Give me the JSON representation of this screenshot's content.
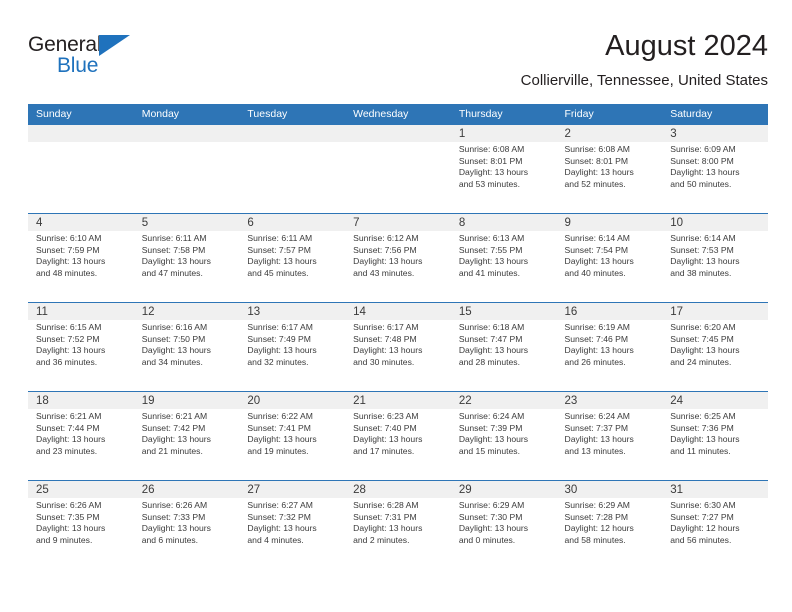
{
  "brand": {
    "name_part1": "General",
    "name_part2": "Blue",
    "accent_color": "#1f72bd"
  },
  "header": {
    "month_title": "August 2024",
    "location": "Collierville, Tennessee, United States"
  },
  "theme": {
    "header_blue": "#2e75b6",
    "day_band_gray": "#f0f0f0",
    "text_color": "#3b3b3b"
  },
  "calendar": {
    "weekday_headers": [
      "Sunday",
      "Monday",
      "Tuesday",
      "Wednesday",
      "Thursday",
      "Friday",
      "Saturday"
    ],
    "weeks": [
      [
        {
          "day": "",
          "sunrise": "",
          "sunset": "",
          "daylight_line1": "",
          "daylight_line2": ""
        },
        {
          "day": "",
          "sunrise": "",
          "sunset": "",
          "daylight_line1": "",
          "daylight_line2": ""
        },
        {
          "day": "",
          "sunrise": "",
          "sunset": "",
          "daylight_line1": "",
          "daylight_line2": ""
        },
        {
          "day": "",
          "sunrise": "",
          "sunset": "",
          "daylight_line1": "",
          "daylight_line2": ""
        },
        {
          "day": "1",
          "sunrise": "Sunrise: 6:08 AM",
          "sunset": "Sunset: 8:01 PM",
          "daylight_line1": "Daylight: 13 hours",
          "daylight_line2": "and 53 minutes."
        },
        {
          "day": "2",
          "sunrise": "Sunrise: 6:08 AM",
          "sunset": "Sunset: 8:01 PM",
          "daylight_line1": "Daylight: 13 hours",
          "daylight_line2": "and 52 minutes."
        },
        {
          "day": "3",
          "sunrise": "Sunrise: 6:09 AM",
          "sunset": "Sunset: 8:00 PM",
          "daylight_line1": "Daylight: 13 hours",
          "daylight_line2": "and 50 minutes."
        }
      ],
      [
        {
          "day": "4",
          "sunrise": "Sunrise: 6:10 AM",
          "sunset": "Sunset: 7:59 PM",
          "daylight_line1": "Daylight: 13 hours",
          "daylight_line2": "and 48 minutes."
        },
        {
          "day": "5",
          "sunrise": "Sunrise: 6:11 AM",
          "sunset": "Sunset: 7:58 PM",
          "daylight_line1": "Daylight: 13 hours",
          "daylight_line2": "and 47 minutes."
        },
        {
          "day": "6",
          "sunrise": "Sunrise: 6:11 AM",
          "sunset": "Sunset: 7:57 PM",
          "daylight_line1": "Daylight: 13 hours",
          "daylight_line2": "and 45 minutes."
        },
        {
          "day": "7",
          "sunrise": "Sunrise: 6:12 AM",
          "sunset": "Sunset: 7:56 PM",
          "daylight_line1": "Daylight: 13 hours",
          "daylight_line2": "and 43 minutes."
        },
        {
          "day": "8",
          "sunrise": "Sunrise: 6:13 AM",
          "sunset": "Sunset: 7:55 PM",
          "daylight_line1": "Daylight: 13 hours",
          "daylight_line2": "and 41 minutes."
        },
        {
          "day": "9",
          "sunrise": "Sunrise: 6:14 AM",
          "sunset": "Sunset: 7:54 PM",
          "daylight_line1": "Daylight: 13 hours",
          "daylight_line2": "and 40 minutes."
        },
        {
          "day": "10",
          "sunrise": "Sunrise: 6:14 AM",
          "sunset": "Sunset: 7:53 PM",
          "daylight_line1": "Daylight: 13 hours",
          "daylight_line2": "and 38 minutes."
        }
      ],
      [
        {
          "day": "11",
          "sunrise": "Sunrise: 6:15 AM",
          "sunset": "Sunset: 7:52 PM",
          "daylight_line1": "Daylight: 13 hours",
          "daylight_line2": "and 36 minutes."
        },
        {
          "day": "12",
          "sunrise": "Sunrise: 6:16 AM",
          "sunset": "Sunset: 7:50 PM",
          "daylight_line1": "Daylight: 13 hours",
          "daylight_line2": "and 34 minutes."
        },
        {
          "day": "13",
          "sunrise": "Sunrise: 6:17 AM",
          "sunset": "Sunset: 7:49 PM",
          "daylight_line1": "Daylight: 13 hours",
          "daylight_line2": "and 32 minutes."
        },
        {
          "day": "14",
          "sunrise": "Sunrise: 6:17 AM",
          "sunset": "Sunset: 7:48 PM",
          "daylight_line1": "Daylight: 13 hours",
          "daylight_line2": "and 30 minutes."
        },
        {
          "day": "15",
          "sunrise": "Sunrise: 6:18 AM",
          "sunset": "Sunset: 7:47 PM",
          "daylight_line1": "Daylight: 13 hours",
          "daylight_line2": "and 28 minutes."
        },
        {
          "day": "16",
          "sunrise": "Sunrise: 6:19 AM",
          "sunset": "Sunset: 7:46 PM",
          "daylight_line1": "Daylight: 13 hours",
          "daylight_line2": "and 26 minutes."
        },
        {
          "day": "17",
          "sunrise": "Sunrise: 6:20 AM",
          "sunset": "Sunset: 7:45 PM",
          "daylight_line1": "Daylight: 13 hours",
          "daylight_line2": "and 24 minutes."
        }
      ],
      [
        {
          "day": "18",
          "sunrise": "Sunrise: 6:21 AM",
          "sunset": "Sunset: 7:44 PM",
          "daylight_line1": "Daylight: 13 hours",
          "daylight_line2": "and 23 minutes."
        },
        {
          "day": "19",
          "sunrise": "Sunrise: 6:21 AM",
          "sunset": "Sunset: 7:42 PM",
          "daylight_line1": "Daylight: 13 hours",
          "daylight_line2": "and 21 minutes."
        },
        {
          "day": "20",
          "sunrise": "Sunrise: 6:22 AM",
          "sunset": "Sunset: 7:41 PM",
          "daylight_line1": "Daylight: 13 hours",
          "daylight_line2": "and 19 minutes."
        },
        {
          "day": "21",
          "sunrise": "Sunrise: 6:23 AM",
          "sunset": "Sunset: 7:40 PM",
          "daylight_line1": "Daylight: 13 hours",
          "daylight_line2": "and 17 minutes."
        },
        {
          "day": "22",
          "sunrise": "Sunrise: 6:24 AM",
          "sunset": "Sunset: 7:39 PM",
          "daylight_line1": "Daylight: 13 hours",
          "daylight_line2": "and 15 minutes."
        },
        {
          "day": "23",
          "sunrise": "Sunrise: 6:24 AM",
          "sunset": "Sunset: 7:37 PM",
          "daylight_line1": "Daylight: 13 hours",
          "daylight_line2": "and 13 minutes."
        },
        {
          "day": "24",
          "sunrise": "Sunrise: 6:25 AM",
          "sunset": "Sunset: 7:36 PM",
          "daylight_line1": "Daylight: 13 hours",
          "daylight_line2": "and 11 minutes."
        }
      ],
      [
        {
          "day": "25",
          "sunrise": "Sunrise: 6:26 AM",
          "sunset": "Sunset: 7:35 PM",
          "daylight_line1": "Daylight: 13 hours",
          "daylight_line2": "and 9 minutes."
        },
        {
          "day": "26",
          "sunrise": "Sunrise: 6:26 AM",
          "sunset": "Sunset: 7:33 PM",
          "daylight_line1": "Daylight: 13 hours",
          "daylight_line2": "and 6 minutes."
        },
        {
          "day": "27",
          "sunrise": "Sunrise: 6:27 AM",
          "sunset": "Sunset: 7:32 PM",
          "daylight_line1": "Daylight: 13 hours",
          "daylight_line2": "and 4 minutes."
        },
        {
          "day": "28",
          "sunrise": "Sunrise: 6:28 AM",
          "sunset": "Sunset: 7:31 PM",
          "daylight_line1": "Daylight: 13 hours",
          "daylight_line2": "and 2 minutes."
        },
        {
          "day": "29",
          "sunrise": "Sunrise: 6:29 AM",
          "sunset": "Sunset: 7:30 PM",
          "daylight_line1": "Daylight: 13 hours",
          "daylight_line2": "and 0 minutes."
        },
        {
          "day": "30",
          "sunrise": "Sunrise: 6:29 AM",
          "sunset": "Sunset: 7:28 PM",
          "daylight_line1": "Daylight: 12 hours",
          "daylight_line2": "and 58 minutes."
        },
        {
          "day": "31",
          "sunrise": "Sunrise: 6:30 AM",
          "sunset": "Sunset: 7:27 PM",
          "daylight_line1": "Daylight: 12 hours",
          "daylight_line2": "and 56 minutes."
        }
      ]
    ]
  }
}
